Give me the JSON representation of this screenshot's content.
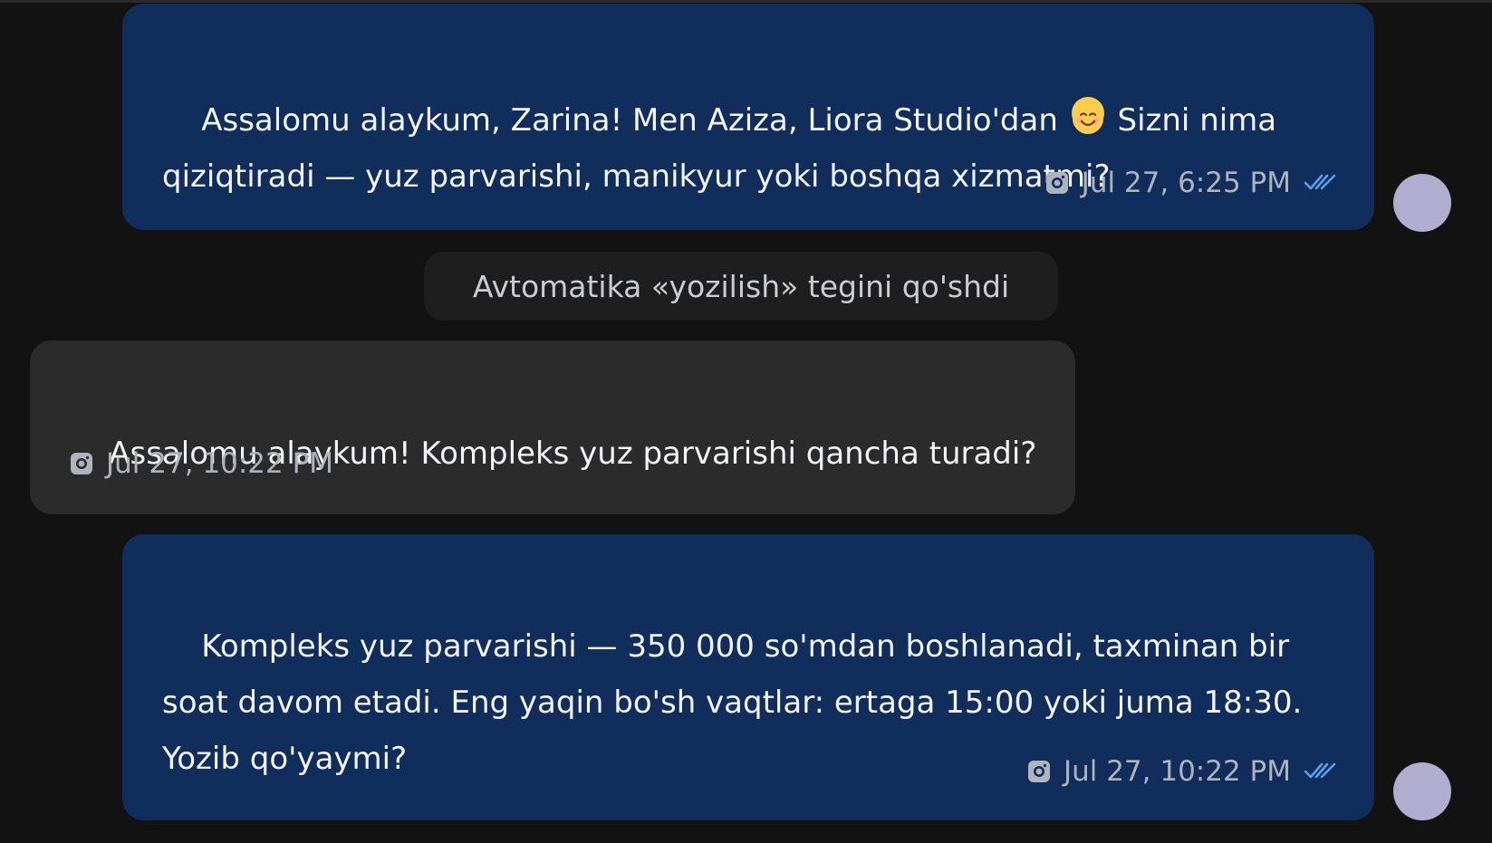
{
  "messages": [
    {
      "line1_before_emoji": "Assalomu alaykum, Zarina! Men Aziza, Liora Studio'dan ",
      "line1_after_emoji": " Sizni nima",
      "line2": "qiziqtiradi — yuz parvarishi, manikyur yoki boshqa xizmatmi?",
      "emoji": "smiling-face-emoji",
      "timestamp": "Jul 27, 6:25 PM",
      "source_icon": "instagram-icon",
      "status_icon": "double-check-icon"
    },
    {
      "system_text": "Avtomatika «yozilish» tegini qo'shdi"
    },
    {
      "text": "Assalomu alaykum! Kompleks yuz parvarishi qancha turadi?",
      "timestamp": "Jul 27, 10:22 PM",
      "source_icon": "instagram-icon"
    },
    {
      "line1": "Kompleks yuz parvarishi — 350 000 so'mdan boshlanadi, taxminan bir",
      "line2": "soat davom etadi. Eng yaqin bo'sh vaqtlar: ertaga 15:00 yoki juma 18:30.",
      "line3": "Yozib qo'yaymi?",
      "timestamp": "Jul 27, 10:22 PM",
      "source_icon": "instagram-icon",
      "status_icon": "double-check-icon"
    }
  ],
  "colors": {
    "background": "#121212",
    "outgoing_bubble": "#112d5b",
    "incoming_bubble": "#2b2b2b",
    "system_pill": "#1e1e1e",
    "read_tick": "#5aa0f0",
    "avatar": "#b1add0"
  }
}
